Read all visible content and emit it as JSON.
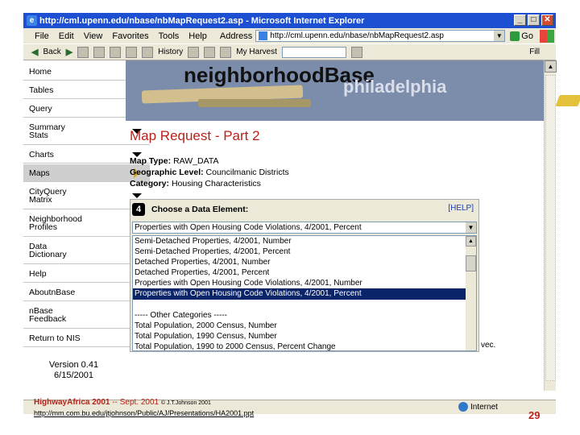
{
  "window": {
    "title": "http://cml.upenn.edu/nbase/nbMapRequest2.asp - Microsoft Internet Explorer",
    "controls": [
      "_",
      "□",
      "✕"
    ]
  },
  "menubar": {
    "items": [
      "File",
      "Edit",
      "View",
      "Favorites",
      "Tools",
      "Help"
    ],
    "address_label": "Address",
    "address_value": "http://cml.upenn.edu/nbase/nbMapRequest2.asp",
    "go_label": "Go"
  },
  "toolbar": {
    "back_label": "Back",
    "history_label": "History",
    "harvest_label": "My Harvest",
    "fill_label": "Fill"
  },
  "nav": {
    "items": [
      {
        "label": "Home"
      },
      {
        "label": "Tables"
      },
      {
        "label": "Query"
      },
      {
        "label": "Summary Stats"
      },
      {
        "label": "Charts"
      },
      {
        "label": "Maps"
      },
      {
        "label": "CityQuery Matrix"
      },
      {
        "label": "Neighborhood Profiles"
      },
      {
        "label": "Data Dictionary"
      },
      {
        "label": "Help"
      },
      {
        "label": "AboutnBase"
      },
      {
        "label": "nBase Feedback"
      },
      {
        "label": "Return to NIS"
      }
    ],
    "version_line1": "Version 0.41",
    "version_line2": "6/15/2001"
  },
  "banner": {
    "title": "neighborhoodBase",
    "subtitle": "philadelphia"
  },
  "main": {
    "page_title": "Map Request - Part 2",
    "map_type_label": "Map Type:",
    "map_type_value": "RAW_DATA",
    "geo_label": "Geographic Level:",
    "geo_value": "Councilmanic Districts",
    "category_label": "Category:",
    "category_value": "Housing Characteristics",
    "step_number": "4",
    "step_label": "Choose a Data Element:",
    "help_link": "[HELP]",
    "selected_value": "Properties with Open Housing Code Violations, 4/2001, Percent",
    "options": [
      "Semi-Detached Properties, 4/2001, Number",
      "Semi-Detached Properties, 4/2001, Percent",
      "Detached Properties, 4/2001, Number",
      "Detached Properties, 4/2001, Percent",
      "Properties with Open Housing Code Violations, 4/2001, Number",
      "Properties with Open Housing Code Violations, 4/2001, Percent",
      "",
      "----- Other Categories -----",
      "Total Population, 2000 Census, Number",
      "Total Population, 1990 Census, Number",
      "Total Population, 1990 to 2000 Census, Percent Change"
    ],
    "trailing_text": "vec."
  },
  "status": {
    "zone_label": "Internet"
  },
  "slide": {
    "footer_title": "HighwayAfrica 2001",
    "footer_date": "-- Sept. 2001",
    "footer_copy": "© J.T.Johnson 2001",
    "footer_url": "http://mm.com.bu.edu/jtjohnson/Public/AJ/Presentations/HA2001.ppt",
    "page_number": "29"
  }
}
